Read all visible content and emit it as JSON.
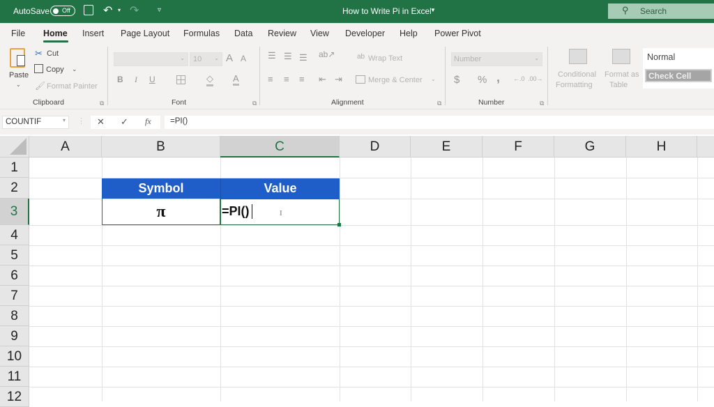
{
  "titlebar": {
    "autosave_label": "AutoSave",
    "autosave_state": "Off",
    "doc_title": "How to Write Pi in Excel",
    "search_placeholder": "Search"
  },
  "tabs": [
    "File",
    "Home",
    "Insert",
    "Page Layout",
    "Formulas",
    "Data",
    "Review",
    "View",
    "Developer",
    "Help",
    "Power Pivot"
  ],
  "active_tab": "Home",
  "ribbon": {
    "clipboard": {
      "paste": "Paste",
      "cut": "Cut",
      "copy": "Copy",
      "format_painter": "Format Painter",
      "group": "Clipboard"
    },
    "font": {
      "font_name": "",
      "font_size": "10",
      "bold": "B",
      "italic": "I",
      "underline": "U",
      "group": "Font"
    },
    "alignment": {
      "wrap_text": "Wrap Text",
      "merge_center": "Merge & Center",
      "group": "Alignment"
    },
    "number": {
      "format": "Number",
      "currency": "$",
      "percent": "%",
      "comma": ",",
      "group": "Number"
    },
    "styles": {
      "conditional_1": "Conditional",
      "conditional_2": "Formatting",
      "format_table_1": "Format as",
      "format_table_2": "Table",
      "style_normal": "Normal",
      "style_check": "Check Cell"
    }
  },
  "formula_bar": {
    "name_box": "COUNTIF",
    "cancel": "✕",
    "enter": "✓",
    "fx": "fx",
    "formula": "=PI()"
  },
  "grid": {
    "columns": [
      "A",
      "B",
      "C",
      "D",
      "E",
      "F",
      "G",
      "H"
    ],
    "rows": [
      "1",
      "2",
      "3",
      "4",
      "5",
      "6",
      "7",
      "8",
      "9",
      "10",
      "11",
      "12"
    ],
    "selected_column": "C",
    "selected_row": "3",
    "cells": {
      "B2": "Symbol",
      "C2": "Value",
      "B3": "π",
      "C3": "=PI()"
    }
  },
  "colors": {
    "excel_green": "#217346",
    "header_blue": "#1f5ec8"
  }
}
